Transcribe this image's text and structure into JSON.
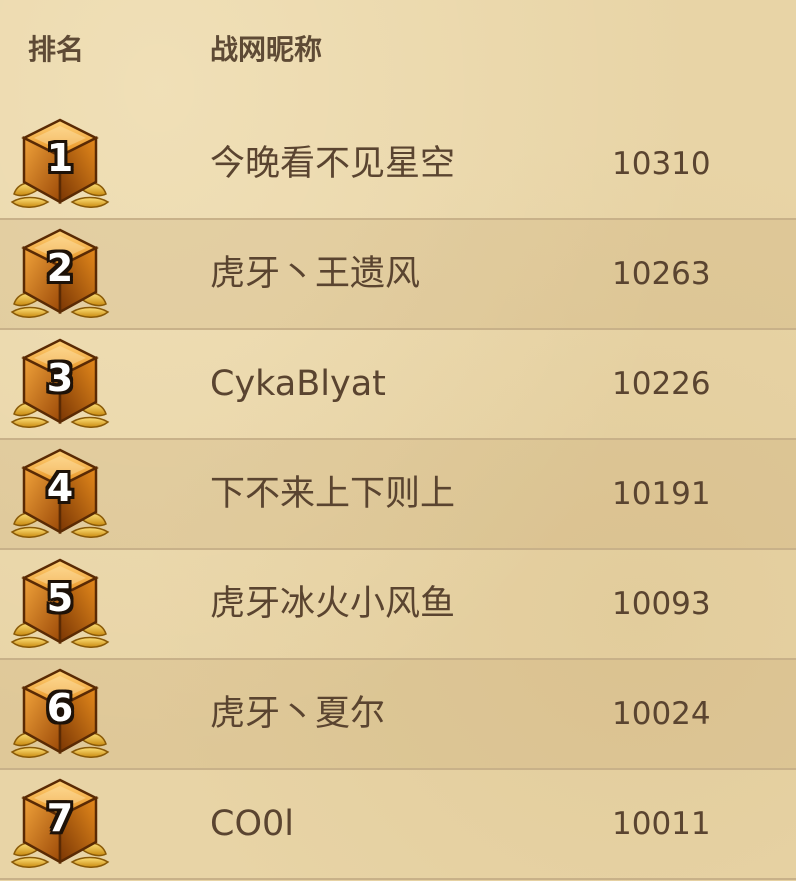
{
  "header": {
    "rank_label": "排名",
    "nickname_label": "战网昵称"
  },
  "rows": [
    {
      "rank": "1",
      "nickname": "今晚看不见星空",
      "score": "10310"
    },
    {
      "rank": "2",
      "nickname": "虎牙丶王遗风",
      "score": "10263"
    },
    {
      "rank": "3",
      "nickname": "CykaBlyat",
      "score": "10226"
    },
    {
      "rank": "4",
      "nickname": "下不来上下则上",
      "score": "10191"
    },
    {
      "rank": "5",
      "nickname": "虎牙冰火小风鱼",
      "score": "10093"
    },
    {
      "rank": "6",
      "nickname": "虎牙丶夏尔",
      "score": "10024"
    },
    {
      "rank": "7",
      "nickname": "CO0l",
      "score": "10011"
    }
  ],
  "icons": {
    "medal": "legend-rank-gem-icon"
  },
  "colors": {
    "background": "#e8d4a6",
    "text": "#5a4430",
    "divider": "#c8b189",
    "gem": "#c8700e",
    "laurel": "#e0a81e"
  }
}
